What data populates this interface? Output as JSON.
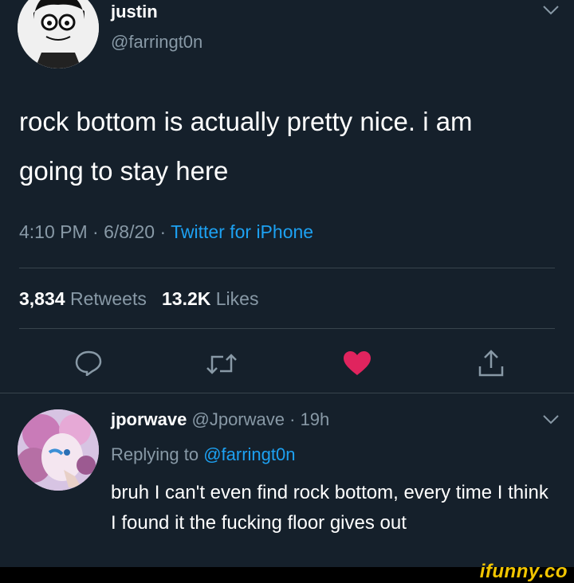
{
  "tweet": {
    "author_name": "justin",
    "author_handle": "@farringt0n",
    "text": "rock bottom is actually pretty nice. i am going to stay here",
    "time": "4:10 PM",
    "date": "6/8/20",
    "source": "Twitter for iPhone",
    "retweets_count": "3,834",
    "retweets_label": "Retweets",
    "likes_count": "13.2K",
    "likes_label": "Likes",
    "meta_sep": " · "
  },
  "reply": {
    "author_name": "jporwave",
    "author_handle": "@Jporwave",
    "time_ago": "19h",
    "replying_to_label": "Replying to",
    "replying_to_handle": "@farringt0n",
    "text": "bruh I can't even find rock bottom, every time I think I found it the fucking floor gives out"
  },
  "icons": {
    "reply": "speech-bubble-icon",
    "retweet": "retweet-icon",
    "like": "heart-icon",
    "share": "share-icon",
    "more": "chevron-down-icon"
  },
  "colors": {
    "background": "#15202b",
    "secondary_text": "#8899a6",
    "link": "#1da1f2",
    "like": "#e0245e",
    "watermark": "#f2c500"
  },
  "watermark": "ifunny.co"
}
